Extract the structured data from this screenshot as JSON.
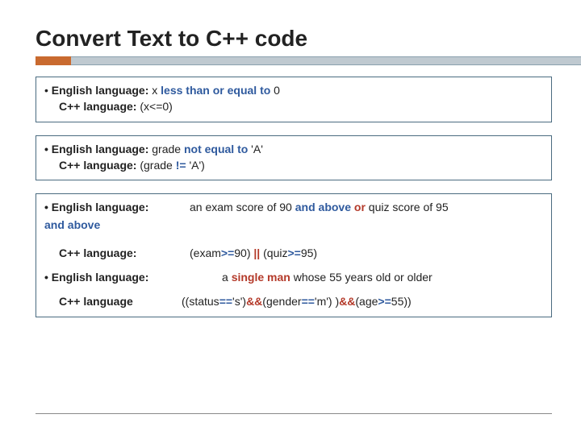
{
  "title": "Convert Text to C++ code",
  "box1": {
    "eng_lbl": "English language:",
    "eng_text_pre": "  x ",
    "eng_text_kw": "less than or equal to",
    "eng_text_post": " 0",
    "cpp_lbl": "C++ language:",
    "cpp_text": "  (x<=0)"
  },
  "box2": {
    "eng_lbl": "English language:",
    "eng_pre": "   grade ",
    "eng_kw": "not  equal to",
    "eng_post": " 'A'",
    "cpp_lbl": "C++ language:",
    "cpp_pre": "    (grade ",
    "cpp_op": "!=",
    "cpp_post": " 'A')"
  },
  "box3": {
    "eng_lbl": "English language:",
    "eng_line1_pre": "an exam score of 90 ",
    "eng_line1_kw1": "and above",
    "eng_line1_kw2": " or ",
    "eng_line1_post": "quiz score of 95",
    "eng_line2": "and above",
    "cpp_lbl": "C++ language:",
    "cpp_a": "(exam",
    "cpp_op1": ">=",
    "cpp_b": "90) ",
    "cpp_or": "||",
    "cpp_c": " (quiz",
    "cpp_op2": ">=",
    "cpp_d": "95)",
    "eng2_lbl": "English language:",
    "eng2_pre": "a ",
    "eng2_kw": "single man",
    "eng2_post": " whose 55 years old or older",
    "cpp2_lbl": "C++ language",
    "cpp2_a": "((status",
    "cpp2_eq1": "==",
    "cpp2_b": "'s')",
    "cpp2_and1": "&&",
    "cpp2_c": "(gender",
    "cpp2_eq2": "==",
    "cpp2_d": "'m') )",
    "cpp2_and2": "&&",
    "cpp2_e": "(age",
    "cpp2_ge": ">=",
    "cpp2_f": "55))"
  }
}
